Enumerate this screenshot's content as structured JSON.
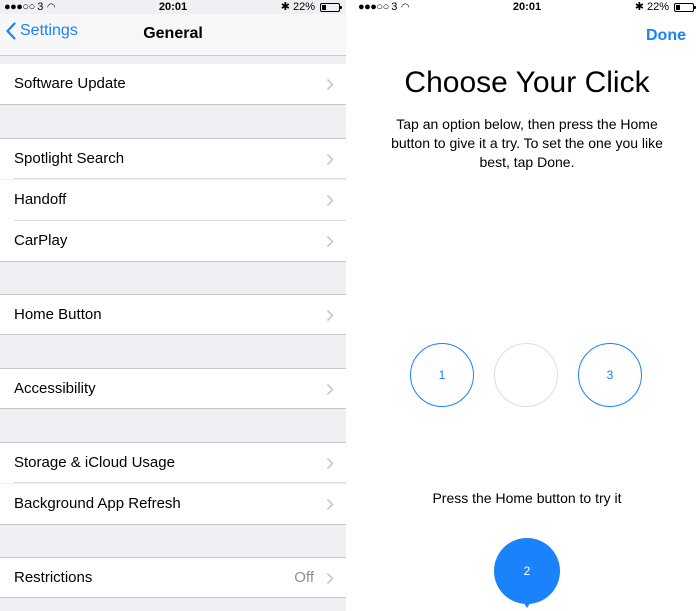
{
  "status_left": {
    "carrier": "●●●○○ 3",
    "time": "20:01",
    "battery": "22%"
  },
  "status_right": {
    "carrier": "●●●○○ 3",
    "time": "20:01",
    "battery": "22%"
  },
  "settings": {
    "back_label": "Settings",
    "title": "General",
    "rows": [
      {
        "label": "Software Update",
        "value": ""
      },
      {
        "label": "Spotlight Search",
        "value": ""
      },
      {
        "label": "Handoff",
        "value": ""
      },
      {
        "label": "CarPlay",
        "value": ""
      },
      {
        "label": "Home Button",
        "value": ""
      },
      {
        "label": "Accessibility",
        "value": ""
      },
      {
        "label": "Storage & iCloud Usage",
        "value": ""
      },
      {
        "label": "Background App Refresh",
        "value": ""
      },
      {
        "label": "Restrictions",
        "value": "Off"
      }
    ]
  },
  "click": {
    "done_label": "Done",
    "headline": "Choose Your Click",
    "instructions": "Tap an option below, then press the Home button to give it a try. To set the one you like best, tap Done.",
    "options": [
      "1",
      "",
      "3"
    ],
    "selected": "2",
    "prompt": "Press the Home button to try it"
  },
  "colors": {
    "accent": "#1a82fb",
    "group_bg": "#efeff4",
    "secondary_text": "#8e8e93"
  }
}
